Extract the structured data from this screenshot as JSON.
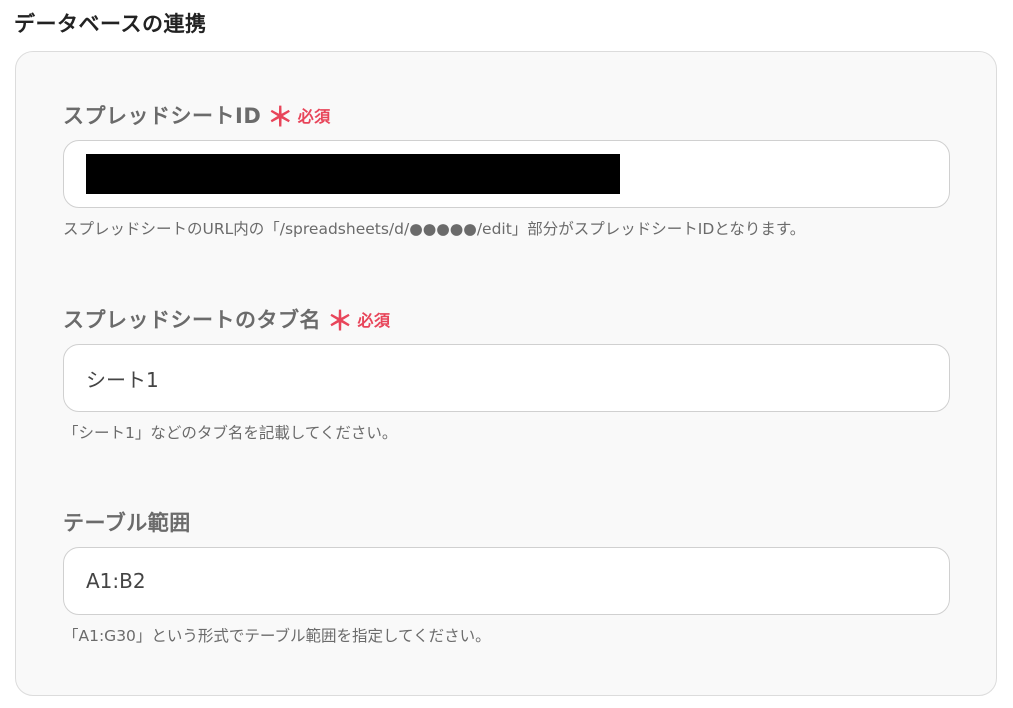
{
  "section": {
    "title": "データベースの連携"
  },
  "fields": {
    "spreadsheet_id": {
      "label": "スプレッドシートID",
      "required_mark": "＊",
      "required_text": "必須",
      "value": "",
      "help": "スプレッドシートのURL内の「/spreadsheets/d/●●●●●/edit」部分がスプレッドシートIDとなります。"
    },
    "tab_name": {
      "label": "スプレッドシートのタブ名",
      "required_mark": "＊",
      "required_text": "必須",
      "value": "シート1",
      "help": "「シート1」などのタブ名を記載してください。"
    },
    "table_range": {
      "label": "テーブル範囲",
      "value": "A1:B2",
      "help": "「A1:G30」という形式でテーブル範囲を指定してください。"
    }
  }
}
